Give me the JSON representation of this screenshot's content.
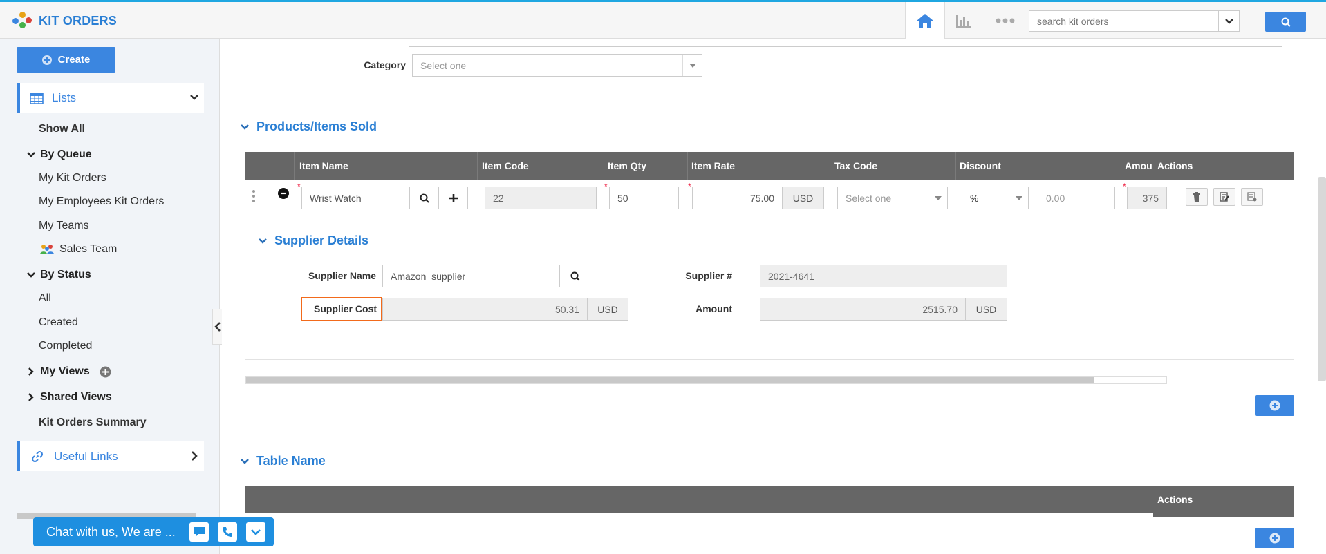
{
  "app": {
    "title": "KIT ORDERS"
  },
  "header": {
    "search_placeholder": "search kit orders",
    "icons": [
      "home-icon",
      "analytics-icon",
      "more-icon",
      "search-icon"
    ]
  },
  "sidebar": {
    "create_label": "Create",
    "lists_label": "Lists",
    "show_all": "Show All",
    "by_queue": "By Queue",
    "queue_items": [
      "My Kit Orders",
      "My Employees Kit Orders",
      "My Teams",
      "Sales Team"
    ],
    "by_status": "By Status",
    "status_items": [
      "All",
      "Created",
      "Completed"
    ],
    "my_views": "My Views",
    "shared_views": "Shared Views",
    "summary": "Kit Orders Summary",
    "useful_links": "Useful Links"
  },
  "chat": {
    "label": "Chat with us, We are ..."
  },
  "form": {
    "category_label": "Category",
    "category_value": "Select one"
  },
  "products": {
    "title": "Products/Items Sold",
    "columns": [
      "Item Name",
      "Item Code",
      "Item Qty",
      "Item Rate",
      "Tax Code",
      "Discount",
      "Amou",
      "Actions"
    ],
    "row": {
      "item_name": "Wrist Watch",
      "item_code": "22",
      "item_qty": "50",
      "item_rate": "75.00",
      "rate_currency": "USD",
      "tax_code": "Select one",
      "discount_type": "%",
      "discount_value": "0.00",
      "amount": "375"
    }
  },
  "supplier": {
    "title": "Supplier Details",
    "name_label": "Supplier Name",
    "name_value": "Amazon  supplier",
    "number_label": "Supplier #",
    "number_value": "2021-4641",
    "cost_label": "Supplier Cost",
    "cost_value": "50.31",
    "cost_currency": "USD",
    "amount_label": "Amount",
    "amount_value": "2515.70",
    "amount_currency": "USD"
  },
  "table_section": {
    "title": "Table Name",
    "actions_header": "Actions"
  },
  "colors": {
    "accent": "#3b86e0",
    "highlight": "#f26a1b",
    "grid_header": "#666666"
  }
}
